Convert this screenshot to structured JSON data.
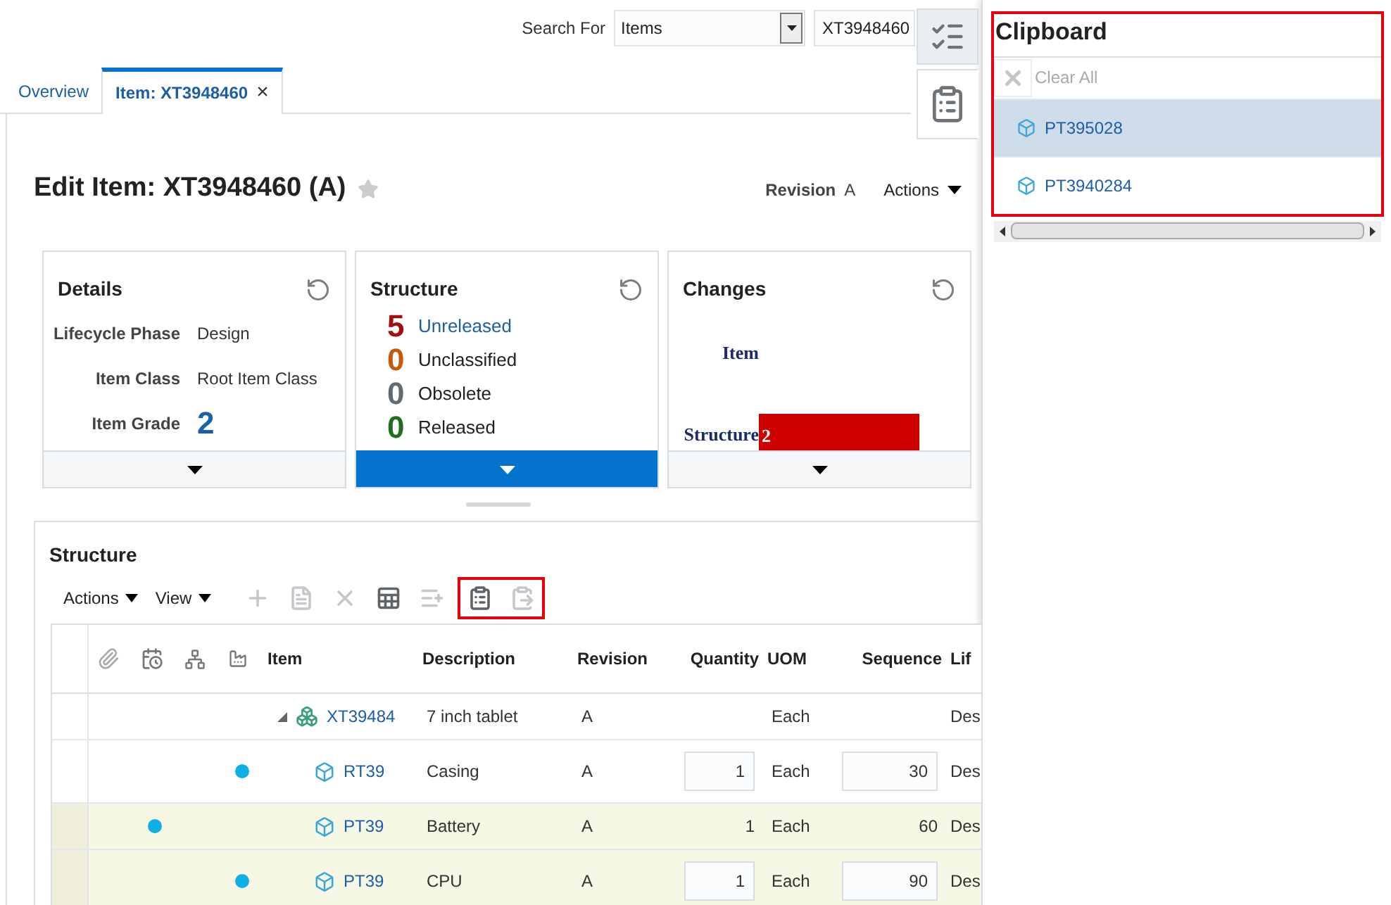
{
  "search": {
    "label": "Search For",
    "type_value": "Items",
    "value": "XT3948460"
  },
  "side_tabs": [
    {
      "selected": false
    },
    {
      "selected": true
    }
  ],
  "tabs": [
    {
      "label": "Overview",
      "selected": false,
      "closable": false
    },
    {
      "label": "Item: XT3948460",
      "selected": true,
      "closable": true,
      "close": "×"
    }
  ],
  "page": {
    "title": "Edit Item: XT3948460 (A)",
    "favorite": false,
    "revision_label": "Revision",
    "revision": "A",
    "actions": "Actions"
  },
  "cards": [
    {
      "kind": "details",
      "title": "Details",
      "selected": false,
      "fields": [
        {
          "label": "Lifecycle Phase",
          "value": "Design",
          "big": false
        },
        {
          "label": "Item Class",
          "value": "Root Item Class",
          "big": false
        },
        {
          "label": "Item Grade",
          "value": "2",
          "big": true
        }
      ]
    },
    {
      "kind": "counts",
      "title": "Structure",
      "selected": true,
      "counts": [
        {
          "count": "5",
          "label": "Unreleased",
          "color": "#a50e0e",
          "link": true
        },
        {
          "count": "0",
          "label": "Unclassified",
          "color": "#c8580d",
          "link": false
        },
        {
          "count": "0",
          "label": "Obsolete",
          "color": "#5f6a72",
          "link": false
        },
        {
          "count": "0",
          "label": "Released",
          "color": "#1d6e1d",
          "link": false
        }
      ]
    },
    {
      "kind": "chart",
      "title": "Changes",
      "selected": false,
      "chart_data": {
        "type": "bar",
        "orientation": "horizontal",
        "categories": [
          "Item",
          "Structure"
        ],
        "values": [
          0,
          2
        ],
        "value_labels": [
          null,
          "2"
        ]
      }
    }
  ],
  "structure": {
    "title": "Structure",
    "menus": [
      "Actions",
      "View"
    ],
    "tools": [
      {
        "disabled": true
      },
      {
        "disabled": true
      },
      {
        "disabled": true
      },
      {
        "disabled": false
      },
      {
        "disabled": true
      },
      {
        "disabled": false,
        "highlighted": true
      },
      {
        "disabled": true,
        "highlighted": true
      }
    ],
    "columns": [
      "Item",
      "Description",
      "Revision",
      "Quantity",
      "UOM",
      "Sequence",
      "Lif"
    ],
    "rows": [
      {
        "item": "XT39484",
        "description": "7 inch tablet",
        "revision": "A",
        "quantity": "",
        "uom": "Each",
        "sequence": "",
        "lifecycle": "Des",
        "selected": false,
        "expanded": true,
        "children": [
          {
            "item": "RT39",
            "description": "Casing",
            "revision": "A",
            "quantity": "1",
            "uom": "Each",
            "sequence": "30",
            "lifecycle": "Des",
            "selected": false,
            "pending_change": false,
            "manufacturer": true,
            "editable": true
          },
          {
            "item": "PT39",
            "description": "Battery",
            "revision": "A",
            "quantity": "1",
            "uom": "Each",
            "sequence": "60",
            "lifecycle": "Des",
            "selected": true,
            "pending_change": true,
            "manufacturer": false,
            "editable": false
          },
          {
            "item": "PT39",
            "description": "CPU",
            "revision": "A",
            "quantity": "1",
            "uom": "Each",
            "sequence": "90",
            "lifecycle": "Des",
            "selected": true,
            "pending_change": false,
            "manufacturer": true,
            "editable": true
          }
        ]
      }
    ]
  },
  "clipboard": {
    "title": "Clipboard",
    "clear_all": "Clear All",
    "items": [
      {
        "label": "PT395028",
        "selected": true
      },
      {
        "label": "PT3940284",
        "selected": false
      }
    ]
  }
}
